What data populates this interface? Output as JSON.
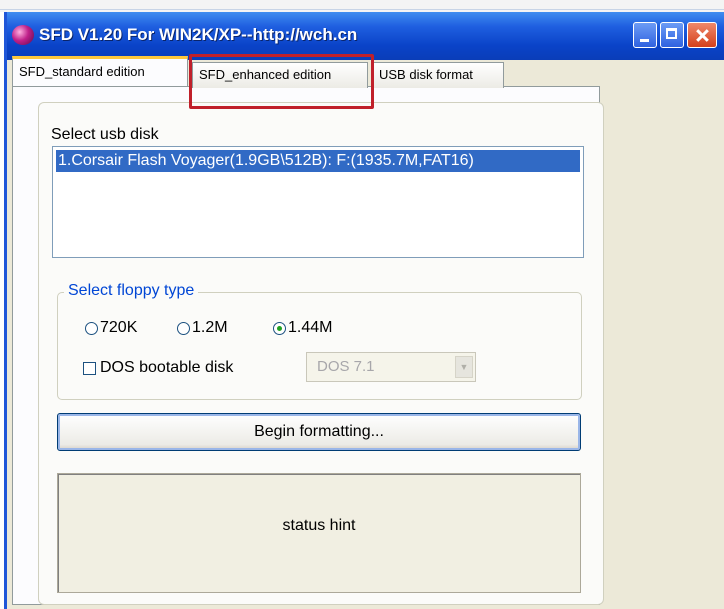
{
  "window": {
    "title": "SFD V1.20 For WIN2K/XP--http://wch.cn"
  },
  "tabs": [
    {
      "label": "SFD_standard edition",
      "active": true
    },
    {
      "label": "SFD_enhanced edition",
      "active": false,
      "highlighted": true
    },
    {
      "label": "USB disk format",
      "active": false
    }
  ],
  "usb": {
    "label": "Select usb disk",
    "items": [
      "1.Corsair Flash Voyager(1.9GB\\512B): F:(1935.7M,FAT16)"
    ],
    "selected_index": 0
  },
  "floppy": {
    "legend": "Select floppy type",
    "options": [
      "720K",
      "1.2M",
      "1.44M"
    ],
    "selected": "1.44M",
    "bootable_label": "DOS bootable disk",
    "bootable_checked": false,
    "dos_version": "DOS 7.1"
  },
  "actions": {
    "begin_label": "Begin formatting..."
  },
  "status": {
    "hint": "status hint"
  },
  "colors": {
    "titlebar": "#0a43c8",
    "selection": "#316ac5",
    "highlight_box": "#c0202a",
    "legend_text": "#0046d5",
    "radio_dot": "#21a121"
  }
}
